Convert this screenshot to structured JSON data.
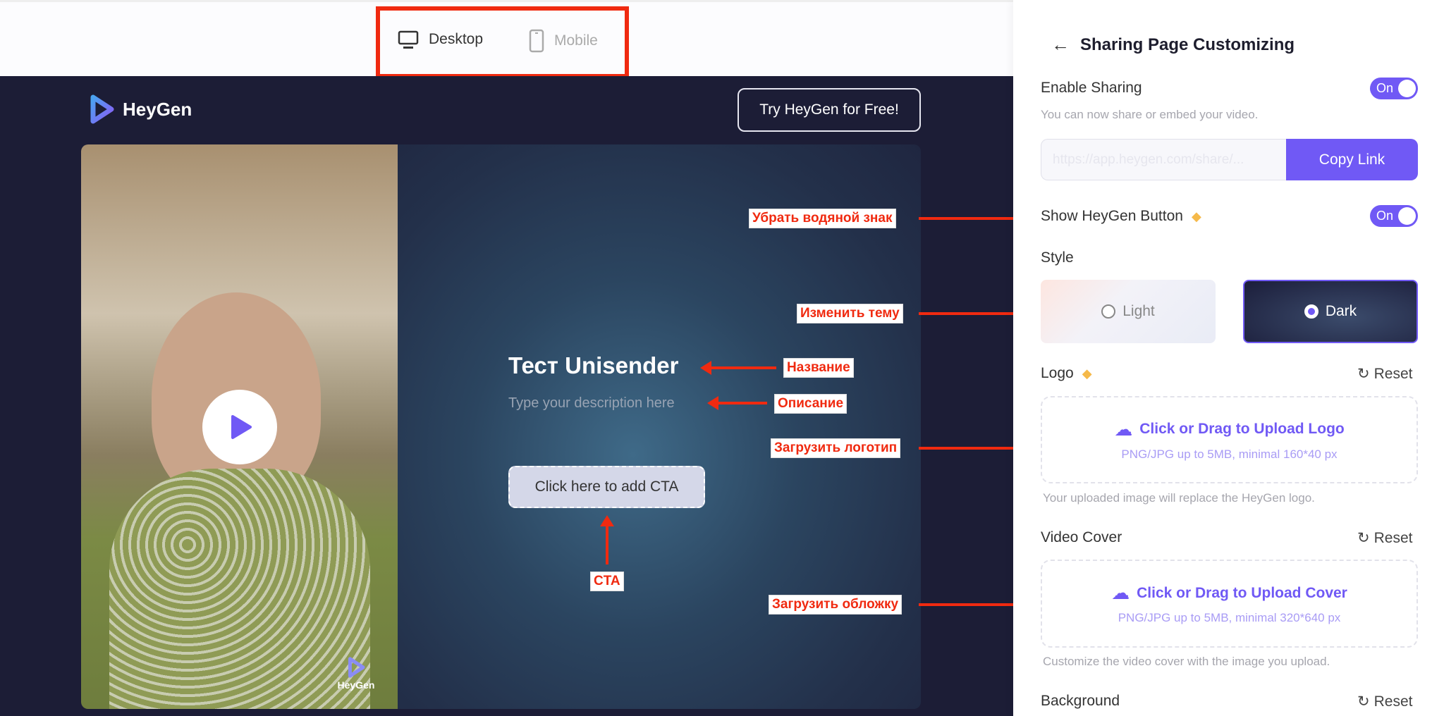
{
  "device_tabs": {
    "desktop": "Desktop",
    "mobile": "Mobile"
  },
  "preview": {
    "brand": "HeyGen",
    "try_button": "Try HeyGen for Free!",
    "title": "Тест Unisender",
    "description_placeholder": "Type your description here",
    "cta": "Click here to add CTA",
    "watermark": "HeyGen"
  },
  "annotations": {
    "watermark": "Убрать водяной знак",
    "theme": "Изменить тему",
    "title": "Название",
    "description": "Описание",
    "logo": "Загрузить логотип",
    "cta": "CTA",
    "cover": "Загрузить обложку"
  },
  "panel": {
    "title": "Sharing Page Customizing",
    "enable_sharing": {
      "label": "Enable Sharing",
      "toggle": "On",
      "hint": "You can now share or embed your video."
    },
    "link": {
      "value": "https://app.heygen.com/share/...",
      "copy": "Copy Link"
    },
    "show_button": {
      "label": "Show HeyGen Button",
      "toggle": "On"
    },
    "style": {
      "label": "Style",
      "light": "Light",
      "dark": "Dark",
      "selected": "Dark"
    },
    "logo": {
      "label": "Logo",
      "reset": "Reset",
      "upload": "Click or Drag to Upload Logo",
      "spec": "PNG/JPG up to 5MB, minimal 160*40 px",
      "hint": "Your uploaded image will replace the HeyGen logo."
    },
    "cover": {
      "label": "Video Cover",
      "reset": "Reset",
      "upload": "Click or Drag to Upload Cover",
      "spec": "PNG/JPG up to 5MB, minimal 320*640 px",
      "hint": "Customize the video cover with the image you upload."
    },
    "background": {
      "label": "Background",
      "reset": "Reset"
    }
  },
  "colors": {
    "accent": "#7059f5",
    "annotation": "#f02a10",
    "stage": "#1c1d36",
    "premium": "#f5b94a"
  }
}
